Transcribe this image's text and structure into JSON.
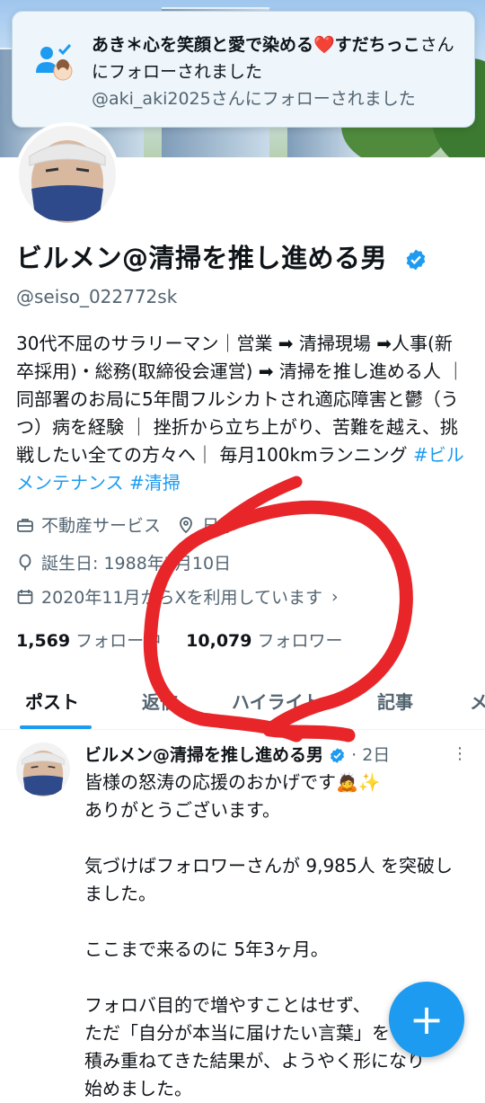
{
  "toast": {
    "name": "あき＊心を笑顔と愛で染める❤️すだちっこ",
    "suffix": "さんにフォローされました",
    "secondary": "@aki_aki2025さんにフォローされました"
  },
  "profile": {
    "display_name": "ビルメン@清掃を推し進める男",
    "handle": "@seiso_022772sk",
    "bio_text": "30代不屈のサラリーマン｜営業 ➡ 清掃現場 ➡人事(新卒採用)・総務(取締役会運営) ➡ 清掃を推し進める人 ｜同部署のお局に5年間フルシカトされ適応障害と鬱（うつ）病を経験 ｜ 挫折から立ち上がり、苦難を越え、挑戦したい全ての方々へ｜ 毎月100kmランニング",
    "bio_tags": [
      "#ビルメンテナンス",
      "#清掃"
    ],
    "category": "不動産サービス",
    "location": "日本",
    "birthday": "誕生日: 1988年7月10日",
    "joined": "2020年11月からXを利用しています",
    "following_count": "1,569",
    "following_label": "フォロー中",
    "followers_count": "10,079",
    "followers_label": "フォロワー"
  },
  "tabs": [
    "ポスト",
    "返信",
    "ハイライト",
    "記事",
    "メ"
  ],
  "post": {
    "author": "ビルメン@清掃を推し進める男",
    "time": "· 2日",
    "lines": [
      "皆様の怒涛の応援のおかげです🙇✨",
      "ありがとうございます。",
      "",
      "気づけばフォロワーさんが 9,985人 を突破しました。",
      "",
      "ここまで来るのに 5年3ヶ月。",
      "",
      "フォロバ目的で増やすことはせず、",
      "ただ「自分が本当に届けたい言葉」を",
      "積み重ねてきた結果が、ようやく形になり",
      "始めました。"
    ]
  },
  "fab_label": "+",
  "colors": {
    "accent": "#1d9bf0",
    "annotation": "#e8262a",
    "text": "#0f1419",
    "muted": "#536471"
  }
}
